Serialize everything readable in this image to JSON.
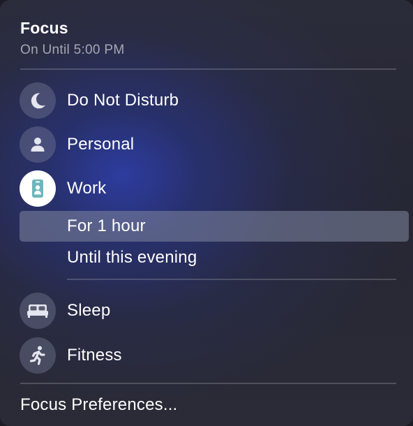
{
  "header": {
    "title": "Focus",
    "subtitle": "On Until 5:00 PM"
  },
  "modes": [
    {
      "label": "Do Not Disturb",
      "icon": "moon-icon"
    },
    {
      "label": "Personal",
      "icon": "person-icon"
    },
    {
      "label": "Work",
      "icon": "id-badge-icon",
      "active": true
    }
  ],
  "work_options": [
    {
      "label": "For 1 hour",
      "highlighted": true
    },
    {
      "label": "Until this evening"
    }
  ],
  "more_modes": [
    {
      "label": "Sleep",
      "icon": "bed-icon"
    },
    {
      "label": "Fitness",
      "icon": "running-figure-icon"
    }
  ],
  "footer": {
    "preferences_label": "Focus Preferences..."
  },
  "colors": {
    "icon_glyph": "#e4e6f0",
    "work_icon_accent": "#6db6bb",
    "highlight": "#5a5e72"
  }
}
